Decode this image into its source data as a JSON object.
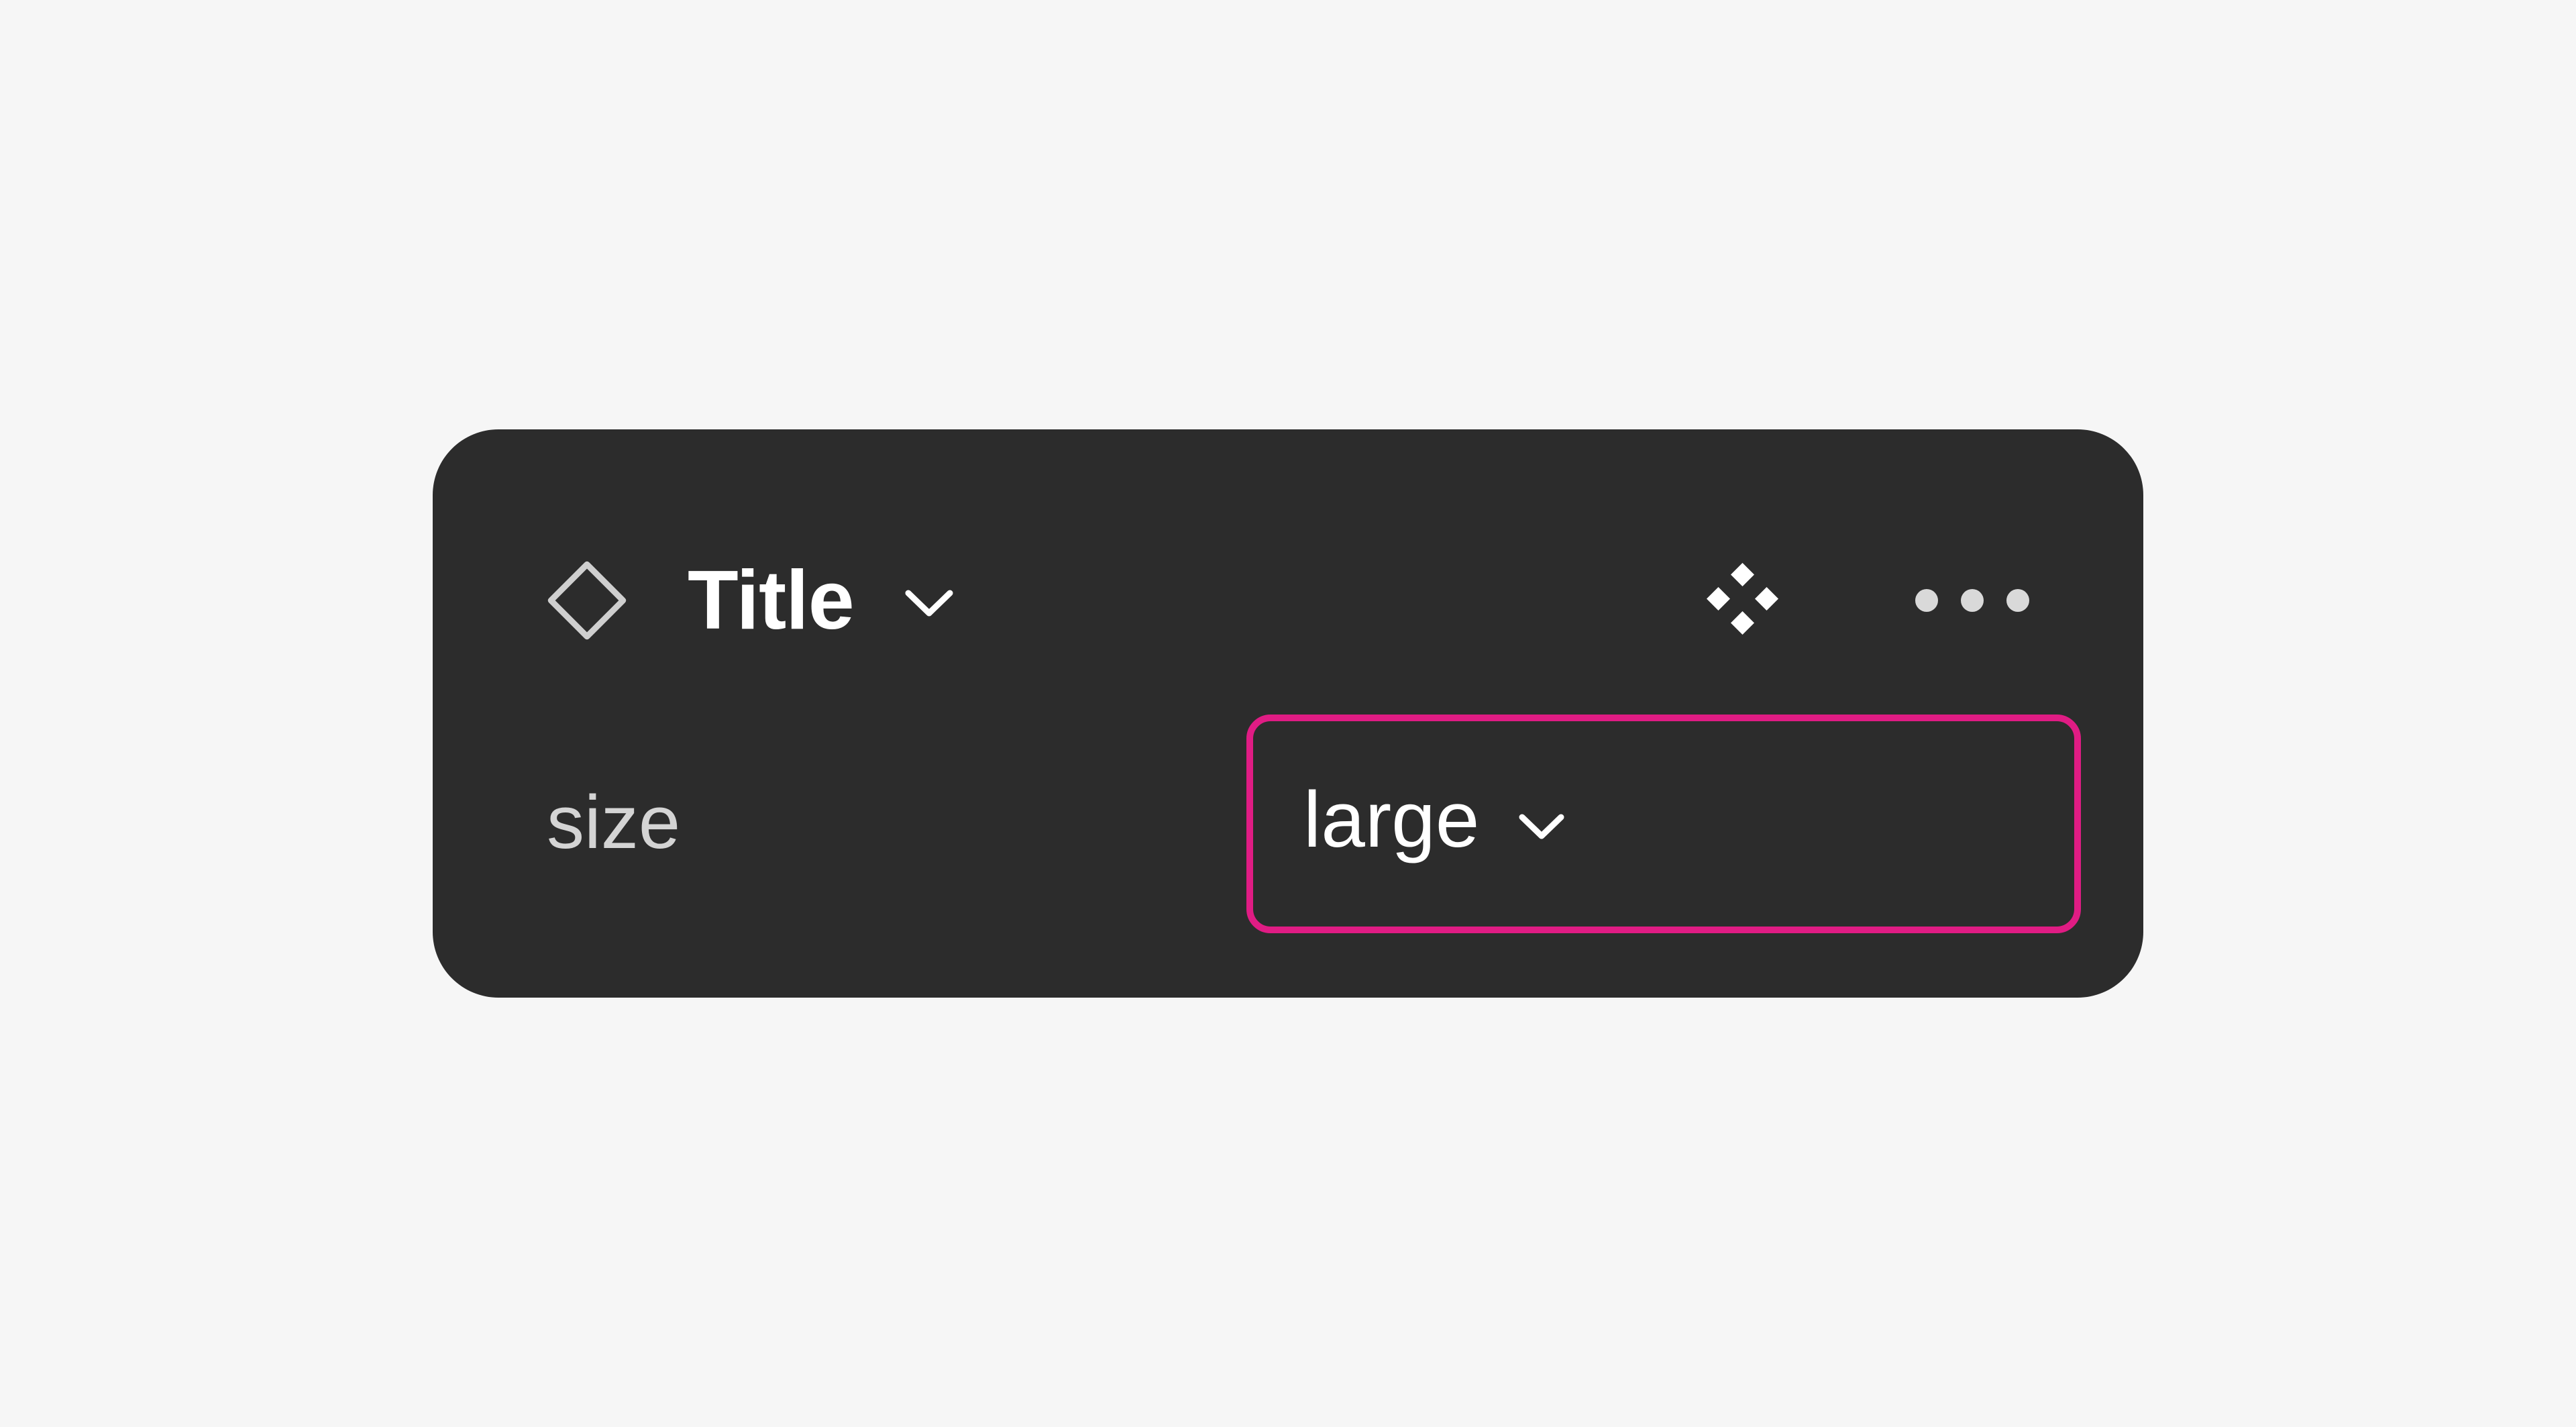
{
  "panel": {
    "header": {
      "title": "Title",
      "instance_icon": "diamond-outline-icon",
      "title_dropdown_icon": "chevron-down-icon",
      "component_icon": "component-diamonds-icon",
      "more_icon": "ellipsis-icon"
    },
    "property": {
      "label": "size",
      "value": "large",
      "dropdown_icon": "chevron-down-icon"
    },
    "colors": {
      "panel_background": "#2c2c2c",
      "page_background": "#f6f6f6",
      "focus_outline": "#e01c84",
      "text_primary": "#ffffff",
      "text_secondary": "#d4d4d4"
    }
  }
}
